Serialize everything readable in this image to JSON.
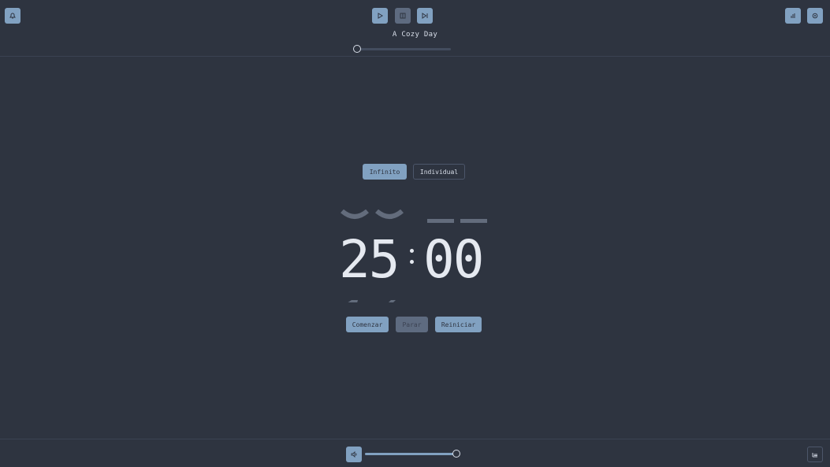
{
  "header": {
    "track_title": "A Cozy Day",
    "progress": 0.0
  },
  "toolbar_icons": {
    "left": "bell-icon",
    "play": "play-icon",
    "pause": "pause-icon",
    "next": "skip-forward-icon",
    "stats": "bar-chart-icon",
    "settings": "gear-icon"
  },
  "modes": {
    "infinite_label": "Infinito",
    "single_label": "Individual",
    "active": "Infinito"
  },
  "timer": {
    "minutes": "25",
    "seconds": "00"
  },
  "controls": {
    "start_label": "Comenzar",
    "stop_label": "Parar",
    "reset_label": "Reiniciar"
  },
  "footer": {
    "volume_icon": "volume-icon",
    "volume_level": 0.96,
    "queue_icon": "list-icon"
  },
  "colors": {
    "background": "#2e3440",
    "accent": "#81a1c1",
    "text": "#e5e9f0"
  }
}
